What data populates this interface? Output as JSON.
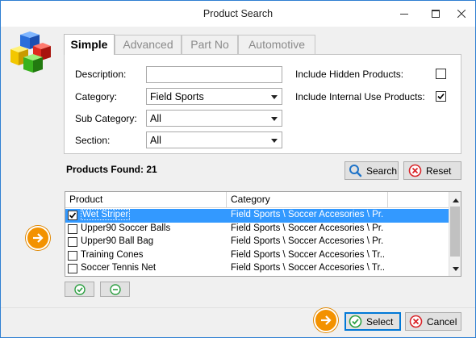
{
  "window": {
    "title": "Product Search"
  },
  "tabs": [
    {
      "label": "Simple",
      "active": true
    },
    {
      "label": "Advanced",
      "active": false
    },
    {
      "label": "Part No",
      "active": false
    },
    {
      "label": "Automotive",
      "active": false
    }
  ],
  "form": {
    "description_label": "Description:",
    "description_value": "",
    "category_label": "Category:",
    "category_value": "Field Sports",
    "subcategory_label": "Sub Category:",
    "subcategory_value": "All",
    "section_label": "Section:",
    "section_value": "All",
    "include_hidden_label": "Include Hidden Products:",
    "include_hidden_checked": false,
    "include_internal_label": "Include Internal Use Products:",
    "include_internal_checked": true
  },
  "results": {
    "found_label": "Products Found: 21",
    "search_label": "Search",
    "reset_label": "Reset"
  },
  "grid": {
    "columns": [
      "Product",
      "Category"
    ],
    "rows": [
      {
        "product": "Wet Striper",
        "category": "Field Sports \\ Soccer Accesories \\ Pr...",
        "checked": true,
        "selected": true
      },
      {
        "product": "Upper90 Soccer Balls",
        "category": "Field Sports \\ Soccer Accesories \\ Pr...",
        "checked": false,
        "selected": false
      },
      {
        "product": "Upper90 Ball Bag",
        "category": "Field Sports \\ Soccer Accesories \\ Pr...",
        "checked": false,
        "selected": false
      },
      {
        "product": "Training Cones",
        "category": "Field Sports \\ Soccer Accesories \\ Tr...",
        "checked": false,
        "selected": false
      },
      {
        "product": "Soccer Tennis Net",
        "category": "Field Sports \\ Soccer Accesories \\ Tr...",
        "checked": false,
        "selected": false
      }
    ]
  },
  "footer": {
    "select_label": "Select",
    "cancel_label": "Cancel"
  },
  "colors": {
    "accent": "#3399ff",
    "pointer": "#f39200",
    "green_icon": "#2ea043",
    "red_icon": "#d9252a",
    "blue_icon": "#1e73c8"
  }
}
